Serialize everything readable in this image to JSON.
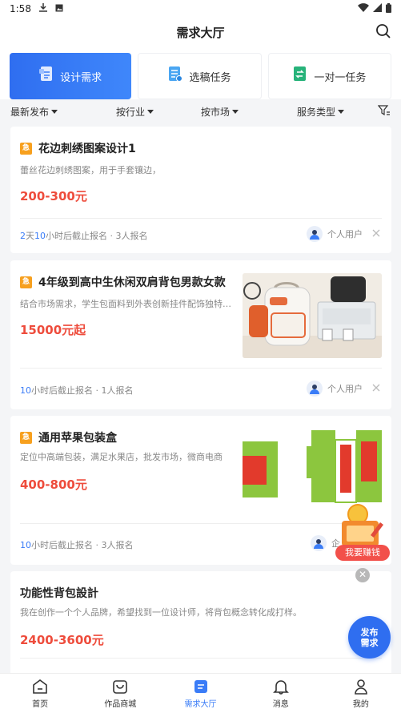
{
  "status": {
    "time": "1:58"
  },
  "header": {
    "title": "需求大厅"
  },
  "tabs": [
    {
      "label": "设计需求",
      "active": true
    },
    {
      "label": "选稿任务",
      "active": false
    },
    {
      "label": "一对一任务",
      "active": false
    }
  ],
  "filters": [
    {
      "label": "最新发布"
    },
    {
      "label": "按行业"
    },
    {
      "label": "按市场"
    },
    {
      "label": "服务类型"
    }
  ],
  "cards": [
    {
      "tag": "急",
      "title": "花边刺绣图案设计1",
      "desc": "蕾丝花边刺绣图案，用于手套镶边，",
      "price": "200-300元",
      "deadline_hl1": "2",
      "deadline_t1": "天",
      "deadline_hl2": "10",
      "deadline_t2": "小时后截止报名 · 3人报名",
      "user": "个人用户"
    },
    {
      "tag": "急",
      "title": "4年级到高中生休闲双肩背包男款女款",
      "desc": "结合市场需求，学生包面料到外表创新挂件配饰独特…",
      "price": "15000元起",
      "deadline_hl": "10",
      "deadline_t": "小时后截止报名 · 1人报名",
      "user": "个人用户"
    },
    {
      "tag": "急",
      "title": "通用苹果包装盒",
      "desc": "定位中高端包装，满足水果店，批发市场，微商电商",
      "price": "400-800元",
      "deadline_hl": "10",
      "deadline_t": "小时后截止报名 · 3人报名",
      "user": "企"
    },
    {
      "title": "功能性背包設計",
      "desc": "我在创作一个个人品牌，希望找到一位设计师，将背包概念转化成打样。",
      "price": "2400-3600元"
    }
  ],
  "floating": {
    "earn_label": "我要赚钱",
    "fab_line1": "发布",
    "fab_line2": "需求",
    "close": "✕"
  },
  "nav": [
    {
      "label": "首页",
      "icon": "home-icon"
    },
    {
      "label": "作品商城",
      "icon": "shop-bag-icon"
    },
    {
      "label": "需求大厅",
      "icon": "demand-hall-icon",
      "active": true
    },
    {
      "label": "消息",
      "icon": "bell-icon"
    },
    {
      "label": "我的",
      "icon": "person-icon"
    }
  ],
  "colors": {
    "accent": "#3a7cf7",
    "price": "#ee4c3c",
    "tag": "#f7a01e"
  }
}
